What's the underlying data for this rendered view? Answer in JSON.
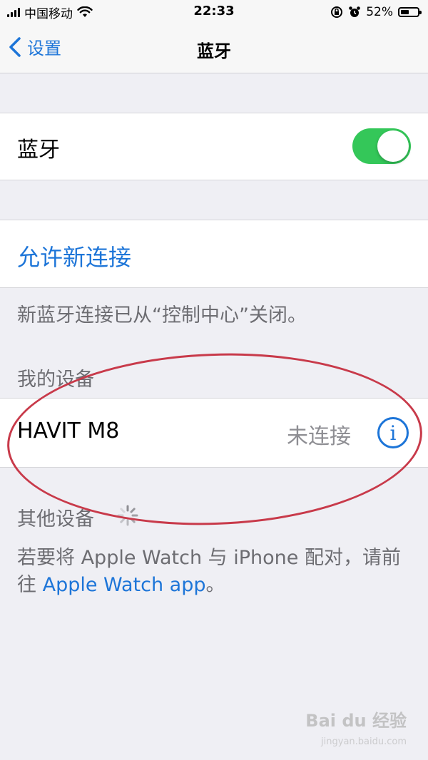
{
  "status_bar": {
    "carrier": "中国移动",
    "time": "22:33",
    "battery_text": "52%",
    "battery_level": 0.52,
    "icons": [
      "signal-bars",
      "wifi",
      "orientation-lock",
      "alarm",
      "battery"
    ]
  },
  "nav": {
    "back_label": "设置",
    "title": "蓝牙"
  },
  "bluetooth": {
    "label": "蓝牙",
    "enabled": true
  },
  "allow_new": {
    "label": "允许新连接",
    "note": "新蓝牙连接已从“控制中心”关闭。"
  },
  "my_devices": {
    "header": "我的设备",
    "devices": [
      {
        "name": "HAVIT M8",
        "status": "未连接"
      }
    ]
  },
  "other_devices": {
    "header": "其他设备",
    "footer_text": "若要将 Apple Watch 与 iPhone 配对，请前往",
    "footer_link": "Apple Watch app",
    "footer_end": "。"
  },
  "watermark": {
    "text": "Bai du 经验",
    "sub": "jingyan.baidu.com"
  },
  "colors": {
    "accent": "#1d75d8",
    "toggle_on": "#34c759",
    "annotation": "#c83a4a",
    "background": "#efeff4"
  }
}
